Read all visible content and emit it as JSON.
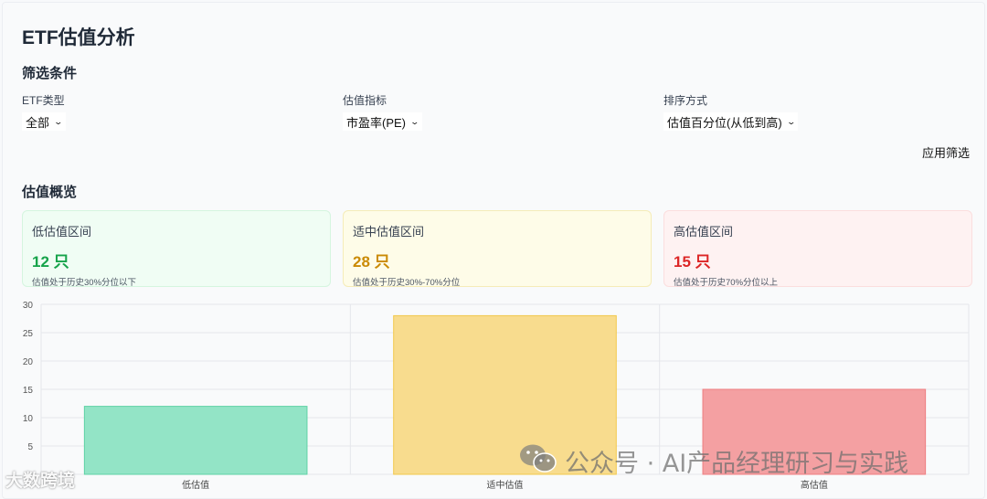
{
  "page": {
    "title": "ETF估值分析"
  },
  "filters": {
    "section_title": "筛选条件",
    "etf_type": {
      "label": "ETF类型",
      "value": "全部"
    },
    "metric": {
      "label": "估值指标",
      "value": "市盈率(PE)"
    },
    "sort": {
      "label": "排序方式",
      "value": "估值百分位(从低到高)"
    },
    "apply_label": "应用筛选"
  },
  "overview": {
    "section_title": "估值概览",
    "cards": [
      {
        "name": "低估值区间",
        "count": "12 只",
        "desc": "估值处于历史30%分位以下",
        "color": "#16a34a"
      },
      {
        "name": "适中估值区间",
        "count": "28 只",
        "desc": "估值处于历史30%-70%分位",
        "color": "#ca8a04"
      },
      {
        "name": "高估值区间",
        "count": "15 只",
        "desc": "估值处于历史70%分位以上",
        "color": "#dc2626"
      }
    ]
  },
  "chart_data": {
    "type": "bar",
    "categories": [
      "低估值",
      "适中估值",
      "高估值"
    ],
    "values": [
      12,
      28,
      15
    ],
    "colors": [
      "#93e4c6",
      "#f8dc8e",
      "#f4a0a2"
    ],
    "border_colors": [
      "#5fd3a5",
      "#f2c84b",
      "#ee7e81"
    ],
    "yticks": [
      5,
      10,
      15,
      20,
      25,
      30
    ],
    "ylim": [
      0,
      30
    ],
    "grid": true
  },
  "watermarks": {
    "main": "公众号 · AI产品经理研习与实践",
    "left": "大数跨境"
  }
}
